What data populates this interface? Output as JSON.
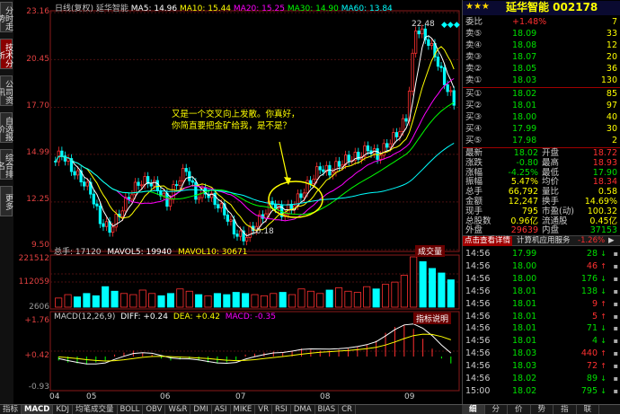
{
  "left_tabs": [
    "分时走势",
    "技术分析",
    "公司资讯",
    "自选报价",
    "综合排名",
    "更多"
  ],
  "kline_header": {
    "period": "日线(复权)",
    "name": "延华智能",
    "ma5": "MA5: 14.96",
    "ma10": "MA10: 15.44",
    "ma20": "MA20: 15.25",
    "ma30": "MA30: 14.90",
    "ma60": "MA60: 13.84",
    "colors": {
      "ma5": "#ffffff",
      "ma10": "#ffff00",
      "ma20": "#ff00ff",
      "ma30": "#00ff00",
      "ma60": "#00ffff"
    }
  },
  "price_axis": [
    "23.16",
    "20.45",
    "17.70",
    "14.99",
    "12.25",
    "9.50"
  ],
  "price_high_label": "22.48",
  "price_low_label": "10.18",
  "vol_header": {
    "total": "总手: 17120",
    "mavol5": "MAVOL5: 19940",
    "mavol10": "MAVOL10: 30671",
    "badge": "成交量"
  },
  "vol_axis": [
    "221512",
    "112059",
    "2606"
  ],
  "macd_header": {
    "title": "MACD(12,26,9)",
    "diff": "DIFF: +0.24",
    "dea": "DEA: +0.42",
    "macd": "MACD: -0.35",
    "badge": "指标说明"
  },
  "macd_axis": [
    "+1.76",
    "+0.42",
    "-0.93"
  ],
  "x_axis": [
    "04",
    "05",
    "06",
    "07",
    "08",
    "09"
  ],
  "annotation": [
    "又是一个交叉向上发散。你真好，",
    "你简直要把金矿给我，是不是？"
  ],
  "stars": "★★★",
  "stock_title": "延华智能 002178",
  "order_book": {
    "ratio": {
      "label": "委比",
      "value": "+1.48%",
      "vol": "7"
    },
    "asks": [
      {
        "label": "卖⑤",
        "price": "18.09",
        "vol": "33"
      },
      {
        "label": "卖④",
        "price": "18.08",
        "vol": "12"
      },
      {
        "label": "卖③",
        "price": "18.07",
        "vol": "20"
      },
      {
        "label": "卖②",
        "price": "18.05",
        "vol": "36"
      },
      {
        "label": "卖①",
        "price": "18.03",
        "vol": "130"
      }
    ],
    "bids": [
      {
        "label": "买①",
        "price": "18.02",
        "vol": "85"
      },
      {
        "label": "买②",
        "price": "18.01",
        "vol": "97"
      },
      {
        "label": "买③",
        "price": "18.00",
        "vol": "40"
      },
      {
        "label": "买④",
        "price": "17.99",
        "vol": "30"
      },
      {
        "label": "买⑤",
        "price": "17.98",
        "vol": "2"
      }
    ]
  },
  "quote": [
    {
      "l1": "最新",
      "v1": "18.02",
      "l2": "开盘",
      "v2": "18.72"
    },
    {
      "l1": "涨跌",
      "v1": "-0.80",
      "l2": "最高",
      "v2": "18.93"
    },
    {
      "l1": "涨幅",
      "v1": "-4.25%",
      "l2": "最低",
      "v2": "17.90"
    },
    {
      "l1": "振幅",
      "v1": "5.47%",
      "l2": "均价",
      "v2": "18.34"
    },
    {
      "l1": "总手",
      "v1": "66,792",
      "l2": "量比",
      "v2": "0.58"
    },
    {
      "l1": "金额",
      "v1": "12,247",
      "l2": "换手",
      "v2": "14.69%"
    },
    {
      "l1": "现手",
      "v1": "795",
      "l2": "市盈(动)",
      "v2": "100.32"
    },
    {
      "l1": "总股数",
      "v1": "0.96亿",
      "l2": "流通股",
      "v2": "0.45亿"
    },
    {
      "l1": "外盘",
      "v1": "29639",
      "l2": "内盘",
      "v2": "37153"
    }
  ],
  "promo": {
    "left": "点击查看详情",
    "mid": "计算机应用服务",
    "pct": "-1.26%"
  },
  "ticks": [
    {
      "time": "14:56",
      "price": "17.99",
      "vol": "28",
      "dir": "down"
    },
    {
      "time": "14:56",
      "price": "18.00",
      "vol": "46",
      "dir": "up"
    },
    {
      "time": "14:56",
      "price": "18.00",
      "vol": "176",
      "dir": "down"
    },
    {
      "time": "14:56",
      "price": "18.01",
      "vol": "138",
      "dir": "down"
    },
    {
      "time": "14:56",
      "price": "18.01",
      "vol": "9",
      "dir": "up"
    },
    {
      "time": "14:56",
      "price": "18.01",
      "vol": "5",
      "dir": "up"
    },
    {
      "time": "14:56",
      "price": "18.01",
      "vol": "71",
      "dir": "down"
    },
    {
      "time": "14:56",
      "price": "18.01",
      "vol": "4",
      "dir": "down"
    },
    {
      "time": "14:56",
      "price": "18.03",
      "vol": "440",
      "dir": "up"
    },
    {
      "time": "14:56",
      "price": "18.03",
      "vol": "72",
      "dir": "up"
    },
    {
      "time": "14:56",
      "price": "18.02",
      "vol": "89",
      "dir": "down"
    },
    {
      "time": "15:00",
      "price": "18.02",
      "vol": "795",
      "dir": "down"
    }
  ],
  "bottom_tabs": [
    "指标",
    "MACD",
    "KDJ",
    "均笔成交量",
    "BOLL",
    "OBV",
    "W&R",
    "DMI",
    "ASI",
    "MIKE",
    "VR",
    "RSI",
    "DMA",
    "BIAS",
    "CR"
  ],
  "right_bottom_tabs": [
    "细",
    "分",
    "价",
    "势",
    "指",
    "联"
  ],
  "chart_data": {
    "type": "candlestick",
    "x": [
      "04",
      "05",
      "06",
      "07",
      "08",
      "09"
    ],
    "ylim": [
      9.5,
      23.16
    ],
    "close_path": [
      14.6,
      15.1,
      14.2,
      13.6,
      12.9,
      11.2,
      10.7,
      11.6,
      12.6,
      13.4,
      13.5,
      13.1,
      12.2,
      13.4,
      14.2,
      12.6,
      12.9,
      12.3,
      11.7,
      10.6,
      10.2,
      10.8,
      11.5,
      12.3,
      11.6,
      12.0,
      12.7,
      13.5,
      14.3,
      14.0,
      14.5,
      14.8,
      14.9,
      15.4,
      14.9,
      15.6,
      16.2,
      17.1,
      22.3,
      21.8,
      20.8,
      19.2,
      18.02
    ],
    "volume": [
      40,
      55,
      45,
      60,
      50,
      90,
      70,
      60,
      55,
      75,
      60,
      50,
      60,
      80,
      70,
      55,
      50,
      60,
      55,
      65,
      60,
      55,
      50,
      60,
      65,
      55,
      80,
      70,
      60,
      75,
      85,
      70,
      65,
      90,
      80,
      100,
      110,
      140,
      221,
      200,
      170,
      150,
      120
    ],
    "macd_hist": [
      -0.2,
      -0.3,
      -0.35,
      -0.4,
      -0.3,
      -0.2,
      0.1,
      0.2,
      0.3,
      0.2,
      0.1,
      -0.1,
      -0.2,
      -0.15,
      -0.1,
      -0.2,
      -0.3,
      -0.35,
      -0.3,
      -0.2,
      0.1,
      0.15,
      0.2,
      0.25,
      0.2,
      0.3,
      0.4,
      0.35,
      0.3,
      0.3,
      0.35,
      0.4,
      0.5,
      0.6,
      0.8,
      1.2,
      1.5,
      1.6,
      1.4,
      0.9,
      0.4,
      -0.1,
      -0.35
    ]
  }
}
